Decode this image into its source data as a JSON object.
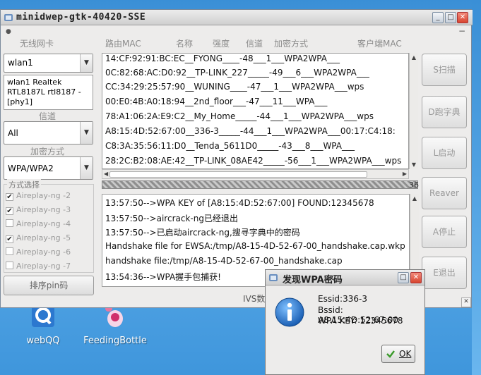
{
  "window": {
    "title": "minidwep-gtk-40420-SSE"
  },
  "headers": {
    "wireless_card": "无线网卡",
    "router_mac": "路由MAC",
    "name": "名称",
    "strength": "强度",
    "channel": "信道",
    "encryption": "加密方式",
    "client_mac": "客户端MAC"
  },
  "left": {
    "interface_value": "wlan1",
    "interface_info": [
      "wlan1 Realtek",
      "RTL8187L rtl8187 -",
      "[phy1]"
    ],
    "channel_label": "信道",
    "channel_value": "All",
    "encryption_label": "加密方式",
    "encryption_value": "WPA/WPA2",
    "mode_label": "方式选择",
    "modes": [
      {
        "label": "Aireplay-ng -2",
        "checked": true
      },
      {
        "label": "Aireplay-ng -3",
        "checked": true
      },
      {
        "label": "Aireplay-ng -4",
        "checked": false
      },
      {
        "label": "Aireplay-ng -5",
        "checked": true
      },
      {
        "label": "Aireplay-ng -6",
        "checked": false
      },
      {
        "label": "Aireplay-ng -7",
        "checked": false
      }
    ],
    "pin_button": "排序pin码"
  },
  "networks": [
    "14:CF:92:91:BC:EC__FYONG____-48___1___WPA2WPA___",
    "0C:82:68:AC:D0:92__TP-LINK_227_____-49___6___WPA2WPA___",
    "CC:34:29:25:57:90__WUNING____-47___1___WPA2WPA___wps",
    "00:E0:4B:A0:18:94__2nd_floor___-47___11___WPA___",
    "78:A1:06:2A:E9:C2__My_Home_____-44___1___WPA2WPA___wps",
    "A8:15:4D:52:67:00__336-3_____-44___1___WPA2WPA___00:17:C4:18:",
    "C8:3A:35:56:11:D0__Tenda_5611D0_____-43___8___WPA___",
    "28:2C:B2:08:AE:42__TP-LINK_08AE42_____-56___1___WPA2WPA___wps"
  ],
  "progress": {
    "percent_label": "36"
  },
  "log": [
    "13:57:50-->WPA KEY of [A8:15:4D:52:67:00] FOUND:12345678",
    "13:57:50-->aircrack-ng已经退出",
    "13:57:50-->已启动aircrack-ng,搜寻字典中的密码",
    "Handshake file for EWSA:/tmp/A8-15-4D-52-67-00_handshake.cap.wkp",
    "handshake file:/tmp/A8-15-4D-52-67-00_handshake.cap",
    "13:54:36-->WPA握手包捕获!"
  ],
  "ivs_label": "IVS数",
  "right_buttons": {
    "scan": "S扫描",
    "dict": "D跑字典",
    "launch": "L启动",
    "reaver": "Reaver",
    "stop": "A停止",
    "exit": "E退出"
  },
  "dialog": {
    "title": "发现WPA密码",
    "essid": "Essid:336-3",
    "bssid": "Bssid: A8:15:4D:52:67:00",
    "key": "WPA KEY: 12345678",
    "ok": "OK"
  },
  "desktop": {
    "icons": [
      {
        "label": "webQQ",
        "icon": "qq-icon"
      },
      {
        "label": "FeedingBottle",
        "icon": "feeding-bottle-icon"
      }
    ]
  }
}
